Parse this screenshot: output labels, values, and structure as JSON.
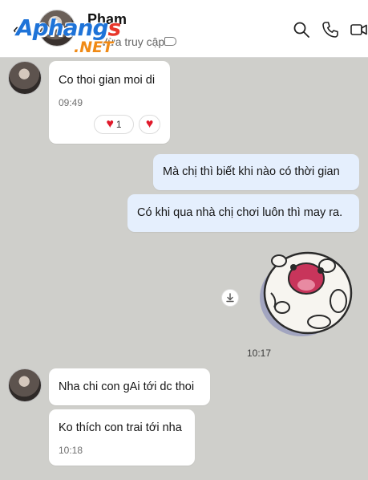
{
  "header": {
    "contact_name": "Pham",
    "status": "Vừa truy cập",
    "watermark_top": "Aphang",
    "watermark_s": "s",
    "watermark_bottom": ".NET",
    "icons": [
      "back-arrow-icon",
      "search-icon",
      "phone-icon",
      "video-call-icon",
      "label-tag-icon"
    ]
  },
  "messages": [
    {
      "side": "in",
      "text": "Co thoi gian moi di",
      "time": "09:49",
      "reaction_count": "1"
    },
    {
      "side": "out",
      "text": "Mà chị thì biết khi nào có thời gian"
    },
    {
      "side": "out",
      "text": "Có khi qua nhà chị chơi luôn thì may ra."
    },
    {
      "side": "out",
      "type": "sticker",
      "time": "10:17"
    },
    {
      "side": "in",
      "text": "Nha chi con gAi tới dc thoi"
    },
    {
      "side": "in",
      "text": "Ko thích con trai tới nha",
      "time": "10:18"
    }
  ],
  "colors": {
    "chat_background": "#cfcfcb",
    "incoming_bubble": "#ffffff",
    "outgoing_bubble": "#e5effd",
    "heart": "#e0192a"
  }
}
